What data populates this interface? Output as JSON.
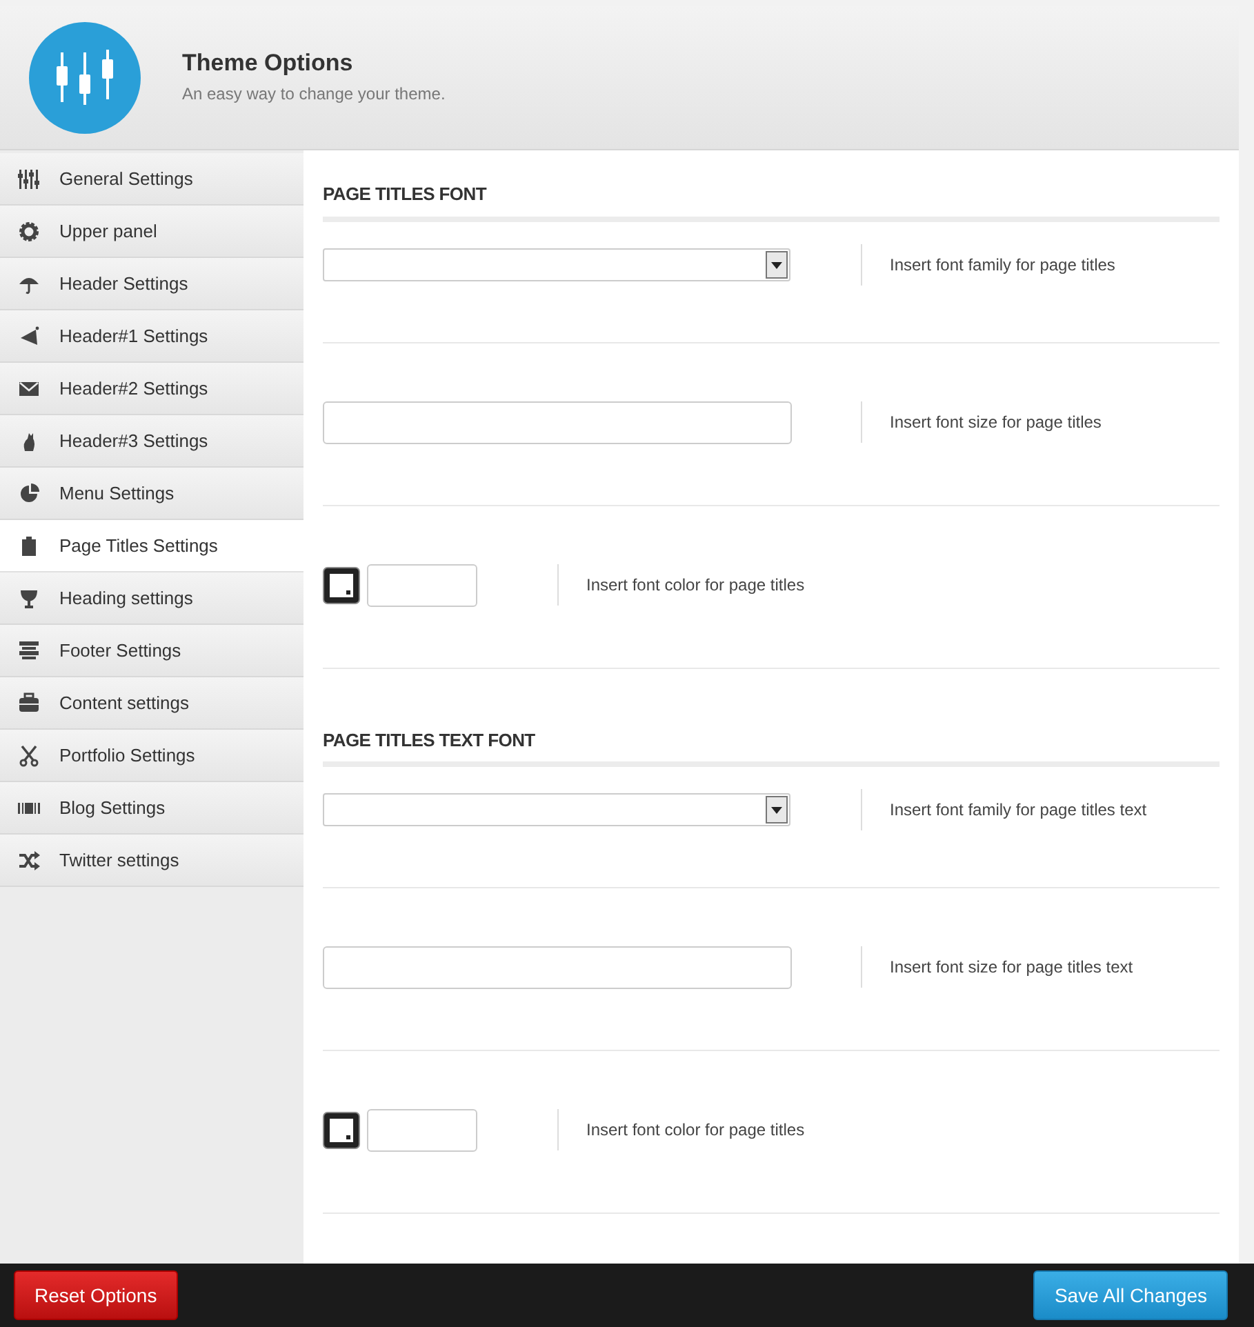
{
  "header": {
    "title": "Theme Options",
    "subtitle": "An easy way to change your theme."
  },
  "sidebar": {
    "items": [
      {
        "label": "General Settings",
        "selected": false
      },
      {
        "label": "Upper panel",
        "selected": false
      },
      {
        "label": "Header Settings",
        "selected": false
      },
      {
        "label": "Header#1 Settings",
        "selected": false
      },
      {
        "label": "Header#2 Settings",
        "selected": false
      },
      {
        "label": "Header#3 Settings",
        "selected": false
      },
      {
        "label": "Menu Settings",
        "selected": false
      },
      {
        "label": "Page Titles Settings",
        "selected": true
      },
      {
        "label": "Heading settings",
        "selected": false
      },
      {
        "label": "Footer Settings",
        "selected": false
      },
      {
        "label": "Content settings",
        "selected": false
      },
      {
        "label": "Portfolio Settings",
        "selected": false
      },
      {
        "label": "Blog Settings",
        "selected": false
      },
      {
        "label": "Twitter settings",
        "selected": false
      }
    ]
  },
  "sections": [
    {
      "title": "PAGE TITLES FONT",
      "rows": [
        {
          "kind": "select",
          "hint": "Insert font family for page titles"
        },
        {
          "kind": "text",
          "hint": "Insert font size for page titles"
        },
        {
          "kind": "color",
          "hint": "Insert font color for page titles"
        }
      ]
    },
    {
      "title": "PAGE TITLES TEXT FONT",
      "rows": [
        {
          "kind": "select",
          "hint": "Insert font family for page titles text"
        },
        {
          "kind": "text",
          "hint": "Insert font size for page titles text"
        },
        {
          "kind": "color",
          "hint": "Insert font color for page titles"
        }
      ]
    }
  ],
  "footer": {
    "reset_button": "Reset Options",
    "save_button": "Save All Changes"
  }
}
